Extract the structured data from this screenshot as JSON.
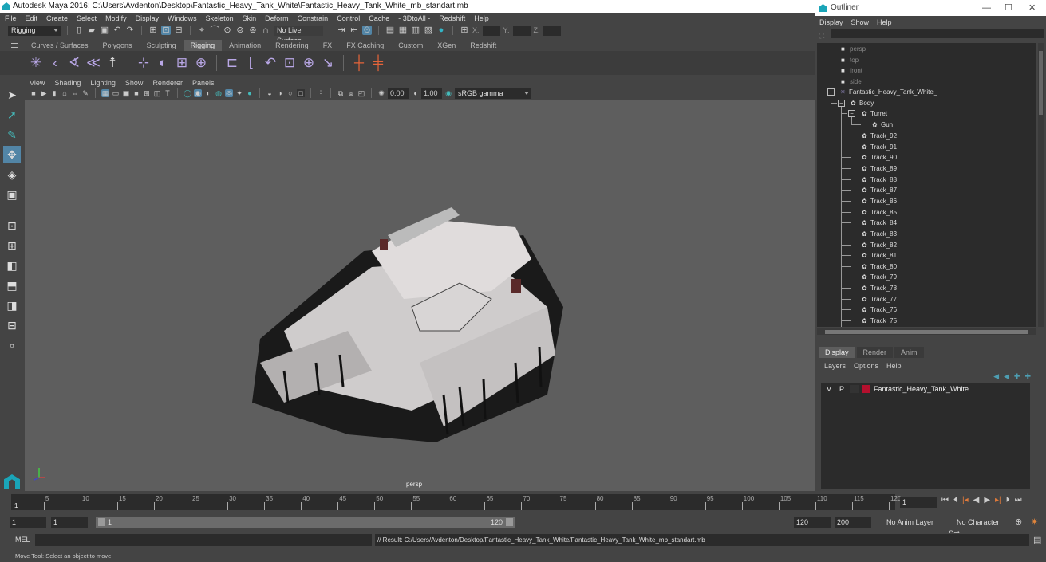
{
  "window": {
    "title": "Autodesk Maya 2016: C:\\Users\\Avdenton\\Desktop\\Fantastic_Heavy_Tank_White\\Fantastic_Heavy_Tank_White_mb_standart.mb"
  },
  "menubar": [
    "File",
    "Edit",
    "Create",
    "Select",
    "Modify",
    "Display",
    "Windows",
    "Skeleton",
    "Skin",
    "Deform",
    "Constrain",
    "Control",
    "Cache",
    "- 3DtoAll -",
    "Redshift",
    "Help"
  ],
  "statusline": {
    "mode": "Rigging",
    "live_surface": "No Live Surface",
    "x_label": "X:",
    "y_label": "Y:",
    "z_label": "Z:",
    "x_value": "",
    "y_value": "",
    "z_value": ""
  },
  "shelf": {
    "tabs": [
      "Curves / Surfaces",
      "Polygons",
      "Sculpting",
      "Rigging",
      "Animation",
      "Rendering",
      "FX",
      "FX Caching",
      "Custom",
      "XGen",
      "Redshift"
    ],
    "active_tab": "Rigging",
    "icons": [
      "create-joints-icon",
      "insert-joint-icon",
      "ik-handle-icon",
      "ik-spline-icon",
      "humanik-icon",
      "bind-skin-icon",
      "interactive-bind-icon",
      "lattice-icon",
      "cluster-icon",
      "parent-constraint-icon",
      "point-constraint-icon",
      "orient-constraint-icon",
      "scale-constraint-icon",
      "aim-constraint-icon",
      "pole-vector-icon",
      "locator-icon",
      "joint-label-icon"
    ]
  },
  "panel": {
    "menu": [
      "View",
      "Shading",
      "Lighting",
      "Show",
      "Renderer",
      "Panels"
    ],
    "exposure": "0.00",
    "gamma": "1.00",
    "color_space": "sRGB gamma",
    "camera_label": "persp"
  },
  "outliner": {
    "title": "Outliner",
    "menu": [
      "Display",
      "Show",
      "Help"
    ],
    "search": "",
    "cameras": [
      "persp",
      "top",
      "front",
      "side"
    ],
    "root": "Fantastic_Heavy_Tank_White_",
    "body": "Body",
    "turret": "Turret",
    "gun": "Gun",
    "tracks": [
      "Track_92",
      "Track_91",
      "Track_90",
      "Track_89",
      "Track_88",
      "Track_87",
      "Track_86",
      "Track_85",
      "Track_84",
      "Track_83",
      "Track_82",
      "Track_81",
      "Track_80",
      "Track_79",
      "Track_78",
      "Track_77",
      "Track_76",
      "Track_75"
    ]
  },
  "layers": {
    "tabs": [
      "Display",
      "Render",
      "Anim"
    ],
    "active_tab": "Display",
    "menu": [
      "Layers",
      "Options",
      "Help"
    ],
    "rows": [
      {
        "v": "V",
        "p": "P",
        "name": "Fantastic_Heavy_Tank_White",
        "color": "#b4102e"
      }
    ]
  },
  "timeline": {
    "ticks": [
      "5",
      "10",
      "15",
      "20",
      "25",
      "30",
      "35",
      "40",
      "45",
      "50",
      "55",
      "60",
      "65",
      "70",
      "75",
      "80",
      "85",
      "90",
      "95",
      "100",
      "105",
      "110",
      "115",
      "120"
    ],
    "start_marker": "1",
    "current_frame": "1",
    "current_frame_progress": 0
  },
  "range": {
    "start": "1",
    "anim_start": "1",
    "slider_start": "1",
    "slider_end": "120",
    "end": "120",
    "anim_end": "200",
    "anim_layer": "No Anim Layer",
    "character_set": "No Character Set"
  },
  "cmd": {
    "language": "MEL",
    "input": "",
    "result": "// Result: C:/Users/Avdenton/Desktop/Fantastic_Heavy_Tank_White/Fantastic_Heavy_Tank_White_mb_standart.mb"
  },
  "help_line": "Move Tool: Select an object to move."
}
